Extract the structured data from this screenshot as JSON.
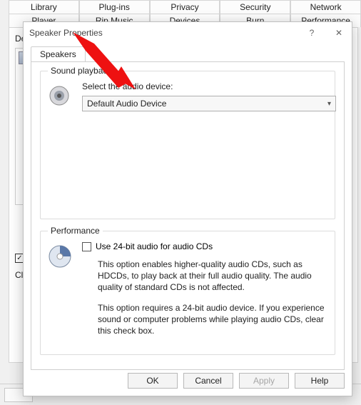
{
  "bg_tabs_row1": [
    "Library",
    "Plug-ins",
    "Privacy",
    "Security",
    "Network"
  ],
  "bg_tabs_row2": [
    "Player",
    "Rip Music",
    "Devices",
    "Burn",
    "Performance"
  ],
  "bg_active_tab": "Devices",
  "bg_devices_label": "De",
  "bg_checkbox_checked": "✓",
  "bg_click_label": "Clic",
  "dialog": {
    "title": "Speaker Properties",
    "help_glyph": "?",
    "close_glyph": "✕",
    "tab": "Speakers",
    "sound_group": {
      "title": "Sound playback",
      "select_label": "Select the audio device:",
      "select_value": "Default Audio Device"
    },
    "perf_group": {
      "title": "Performance",
      "checkbox_label": "Use 24-bit audio for audio CDs",
      "desc1": "This option enables higher-quality audio CDs, such as HDCDs, to play back at their full audio quality. The audio quality of standard CDs is not affected.",
      "desc2": "This option requires a 24-bit audio device. If you experience sound or computer problems while playing audio CDs, clear this check box."
    },
    "buttons": {
      "ok": "OK",
      "cancel": "Cancel",
      "apply": "Apply",
      "help": "Help"
    }
  }
}
